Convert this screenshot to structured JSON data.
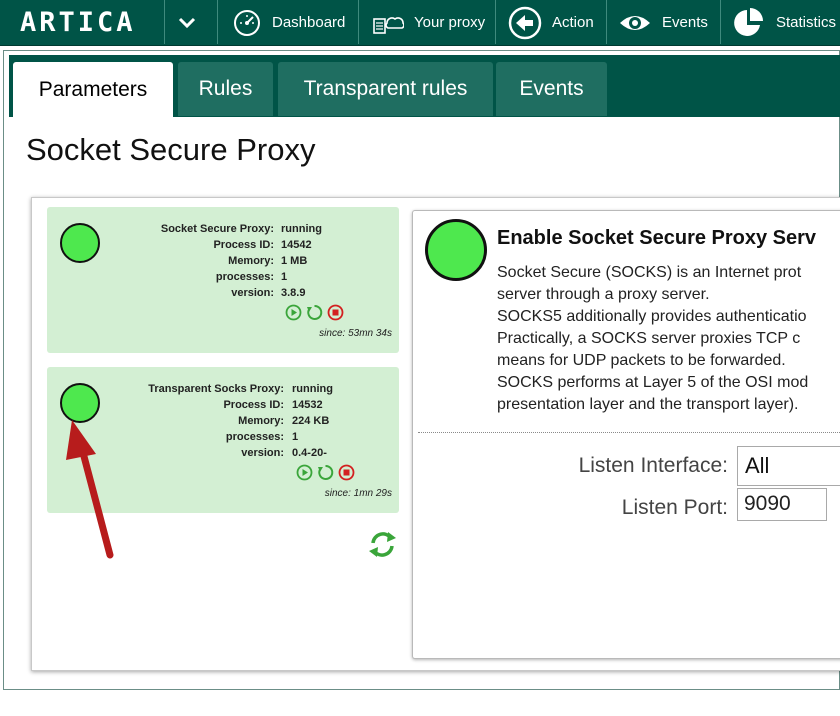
{
  "nav": {
    "logo": "ARTICA",
    "items": [
      {
        "label": "Dashboard",
        "icon": "dashboard-gauge-icon"
      },
      {
        "label": "Your proxy",
        "icon": "proxy-cloud-icon"
      },
      {
        "label": "Action",
        "icon": "action-back-circle-icon"
      },
      {
        "label": "Events",
        "icon": "events-eye-icon"
      },
      {
        "label": "Statistics",
        "icon": "statistics-pie-icon"
      }
    ]
  },
  "tabs": [
    {
      "label": "Parameters",
      "active": true
    },
    {
      "label": "Rules",
      "active": false
    },
    {
      "label": "Transparent rules",
      "active": false
    },
    {
      "label": "Events",
      "active": false
    }
  ],
  "page": {
    "title": "Socket Secure Proxy"
  },
  "services": [
    {
      "name_label": "Socket Secure Proxy:",
      "status": "running",
      "pid_label": "Process ID:",
      "pid": "14542",
      "memory_label": "Memory:",
      "memory": "1 MB",
      "processes_label": "processes:",
      "processes": "1",
      "version_label": "version:",
      "version": "3.8.9",
      "since": "since: 53mn 34s",
      "led_color": "#4ee84e"
    },
    {
      "name_label": "Transparent Socks Proxy:",
      "status": "running",
      "pid_label": "Process ID:",
      "pid": "14532",
      "memory_label": "Memory:",
      "memory": "224 KB",
      "processes_label": "processes:",
      "processes": "1",
      "version_label": "version:",
      "version": "0.4-20-",
      "since": "since: 1mn 29s",
      "led_color": "#4ee84e"
    }
  ],
  "enable": {
    "title": "Enable Socket Secure Proxy Serv",
    "description": [
      "Socket Secure (SOCKS) is an Internet prot",
      "server through a proxy server.",
      "SOCKS5 additionally provides authenticatio",
      "Practically, a SOCKS server proxies TCP c",
      "means for UDP packets to be forwarded.",
      "SOCKS performs at Layer 5 of the OSI mod",
      "presentation layer and the transport layer)."
    ]
  },
  "form": {
    "interface_label": "Listen Interface:",
    "interface_value": "All",
    "port_label": "Listen Port:",
    "port_value": "9090"
  },
  "colors": {
    "brand": "#005447",
    "running": "#4ee84e",
    "panel": "#d3efd3",
    "annotation_arrow": "#b71c1c"
  }
}
